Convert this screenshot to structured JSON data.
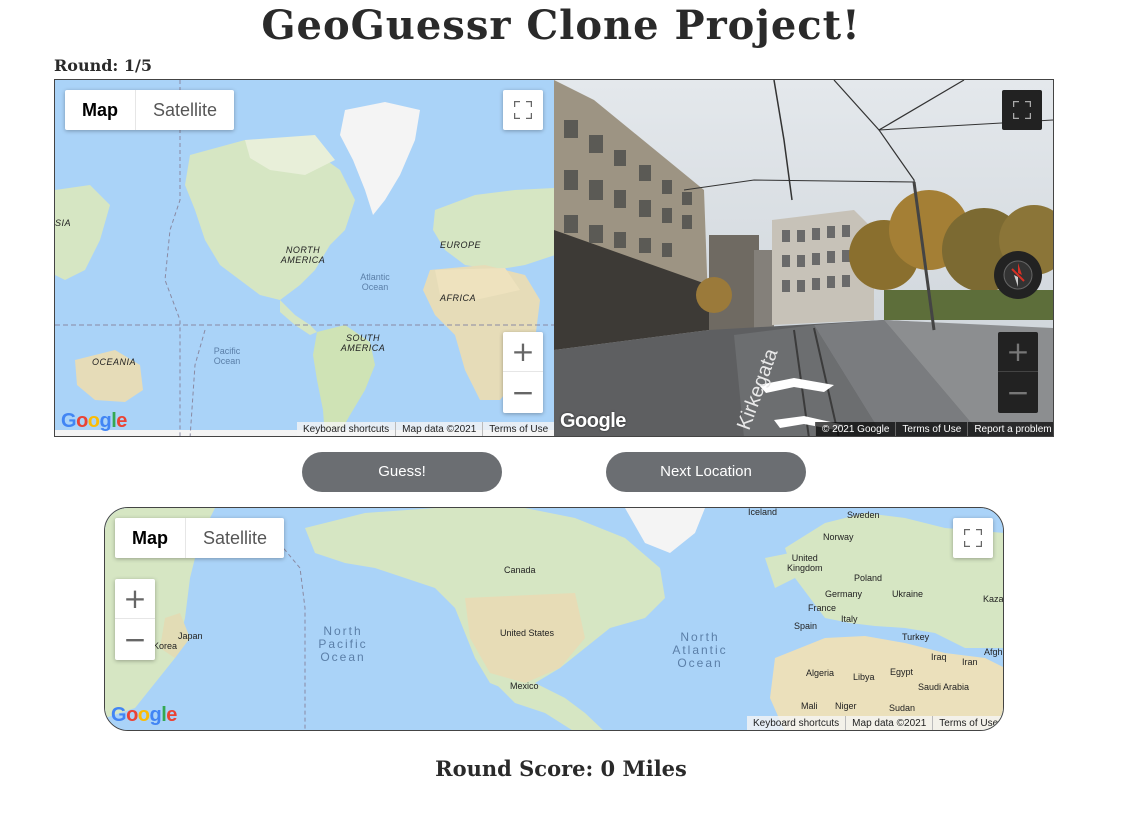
{
  "page": {
    "title": "GeoGuessr Clone Project!",
    "round_label": "Round: 1/5",
    "score_label": "Round Score: 0 Miles"
  },
  "mini_map": {
    "map_tab": "Map",
    "satellite_tab": "Satellite",
    "fullscreen_icon": "fullscreen-icon",
    "zoom_in": "+",
    "zoom_out": "−",
    "attribution": [
      "Keyboard shortcuts",
      "Map data ©2021",
      "Terms of Use"
    ],
    "labels": {
      "north_america": "NORTH\nAMERICA",
      "europe": "EUROPE",
      "africa": "AFRICA",
      "south_america": "SOUTH\nAMERICA",
      "oceania": "OCEANIA",
      "asia": "SIA",
      "atlantic": "Atlantic\nOcean",
      "pacific": "Pacific\nOcean"
    },
    "logo": "Google"
  },
  "street_view": {
    "fullscreen_icon": "fullscreen-icon",
    "zoom_in": "+",
    "zoom_out": "−",
    "road_name": "Kirkegata",
    "attribution": [
      "© 2021 Google",
      "Terms of Use",
      "Report a problem"
    ],
    "logo": "Google"
  },
  "buttons": {
    "guess": "Guess!",
    "next": "Next Location"
  },
  "big_map": {
    "map_tab": "Map",
    "satellite_tab": "Satellite",
    "zoom_in": "+",
    "zoom_out": "−",
    "attribution": [
      "Keyboard shortcuts",
      "Map data ©2021",
      "Terms of Use"
    ],
    "logo": "Google",
    "oceans": {
      "north_pacific": "North\nPacific\nOcean",
      "north_atlantic": "North\nAtlantic\nOcean"
    },
    "countries": {
      "iceland": "Iceland",
      "sweden": "Sweden",
      "norway": "Norway",
      "united_kingdom": "United\nKingdom",
      "poland": "Poland",
      "germany": "Germany",
      "ukraine": "Ukraine",
      "kaza": "Kaza",
      "france": "France",
      "spain": "Spain",
      "italy": "Italy",
      "turkey": "Turkey",
      "canada": "Canada",
      "united_states": "United States",
      "mexico": "Mexico",
      "japan": "Japan",
      "korea": "Korea",
      "algeria": "Algeria",
      "libya": "Libya",
      "egypt": "Egypt",
      "iraq": "Iraq",
      "iran": "Iran",
      "afgh": "Afgh",
      "saudi_arabia": "Saudi Arabia",
      "mali": "Mali",
      "niger": "Niger",
      "sudan": "Sudan"
    }
  }
}
